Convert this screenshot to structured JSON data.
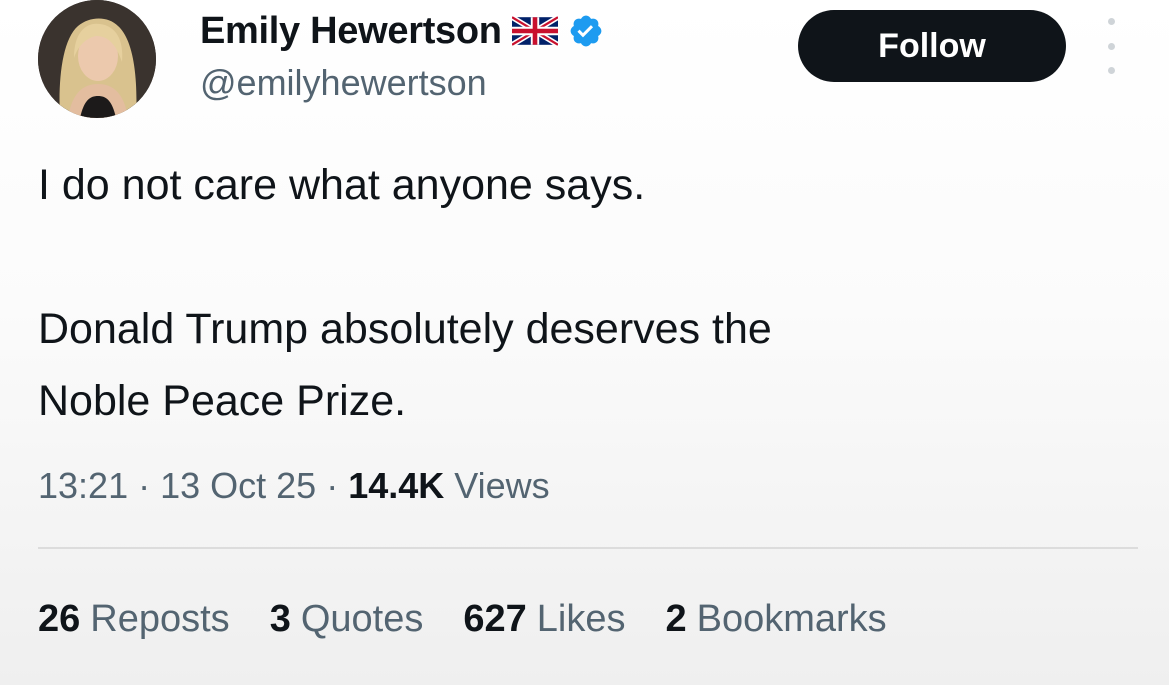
{
  "author": {
    "name": "Emily Hewertson",
    "handle": "@emilyhewertson",
    "flag_icon": "uk-flag-icon",
    "verified_icon": "verified-badge-icon",
    "verified_color": "#1d9bf0"
  },
  "follow_label": "Follow",
  "tweet": {
    "line1": "I do not care what anyone says.",
    "line2": "Donald Trump absolutely deserves the",
    "line3": "Noble Peace Prize."
  },
  "meta": {
    "time": "13:21",
    "separator": "·",
    "date": "13 Oct 25",
    "views_count": "14.4K",
    "views_label": "Views"
  },
  "stats": [
    {
      "count": "26",
      "label": "Reposts"
    },
    {
      "count": "3",
      "label": "Quotes"
    },
    {
      "count": "627",
      "label": "Likes"
    },
    {
      "count": "2",
      "label": "Bookmarks"
    }
  ],
  "colors": {
    "text_primary": "#0f1419",
    "text_secondary": "#536471",
    "button_bg": "#0f1419",
    "button_text": "#ffffff"
  }
}
